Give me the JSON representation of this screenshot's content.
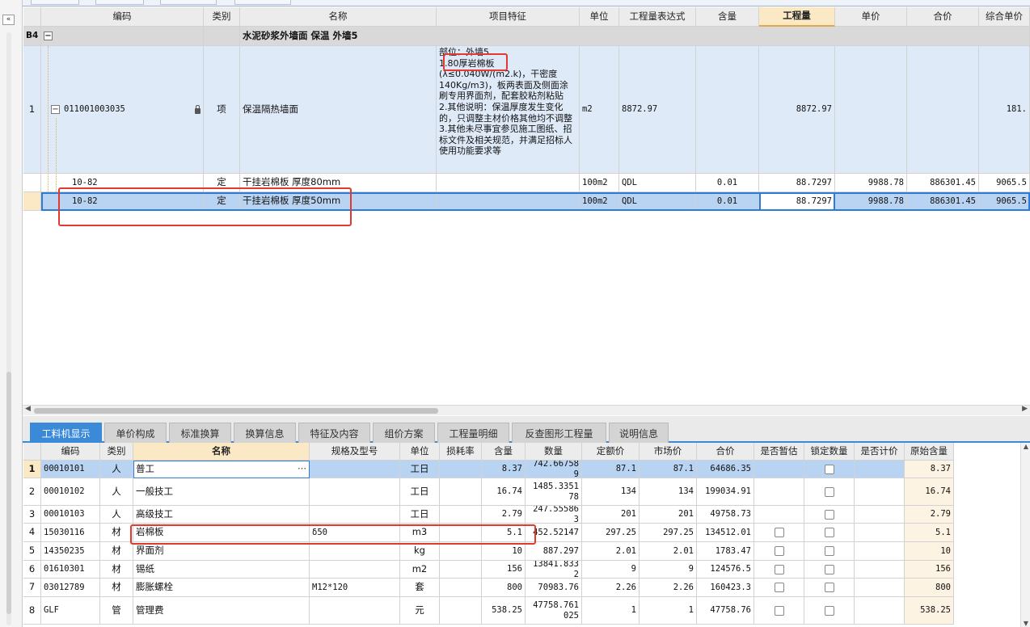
{
  "window": {
    "collapse_label": "«"
  },
  "top_table": {
    "headers": [
      "编码",
      "类别",
      "名称",
      "项目特征",
      "单位",
      "工程量表达式",
      "含量",
      "工程量",
      "单价",
      "合价",
      "综合单价"
    ],
    "section_row": {
      "num": "B4",
      "name": "水泥砂浆外墙面 保温 外墙5"
    },
    "item_row": {
      "num": "1",
      "code": "011001003035",
      "type": "项",
      "name": "保温隔热墙面",
      "features": [
        "部位：外墙5",
        "1.80厚岩棉板(λ≤0.040W/(m2.k)，干密度140Kg/m3)，板两表面及侧面涂刷专用界面剂，配套胶粘剂粘贴",
        "2.其他说明：保温厚度发生变化的，只调整主材价格其他均不调整",
        "3.其他未尽事宜参见施工图纸、招标文件及相关规范，并满足招标人使用功能要求等"
      ],
      "unit": "m2",
      "expr": "8872.97",
      "qty": "8872.97",
      "unit_price": "",
      "total": "",
      "comp_price": "181."
    },
    "sub_rows": [
      {
        "code": "10-82",
        "type": "定",
        "name": "干挂岩棉板 厚度80mm",
        "unit": "100m2",
        "expr": "QDL",
        "content": "0.01",
        "qty": "88.7297",
        "unit_price": "9988.78",
        "total": "886301.45",
        "comp_price": "9065.5"
      },
      {
        "code": "10-82",
        "type": "定",
        "name": "干挂岩棉板 厚度50mm",
        "unit": "100m2",
        "expr": "QDL",
        "content": "0.01",
        "qty": "88.7297",
        "unit_price": "9988.78",
        "total": "886301.45",
        "comp_price": "9065.5"
      }
    ]
  },
  "bottom_tabs": [
    "工料机显示",
    "单价构成",
    "标准换算",
    "换算信息",
    "特征及内容",
    "组价方案",
    "工程量明细",
    "反查图形工程量",
    "说明信息"
  ],
  "bottom_table": {
    "headers": [
      "编码",
      "类别",
      "名称",
      "规格及型号",
      "单位",
      "损耗率",
      "含量",
      "数量",
      "定额价",
      "市场价",
      "合价",
      "是否暂估",
      "锁定数量",
      "是否计价",
      "原始含量"
    ],
    "rows": [
      {
        "num": "1",
        "code": "00010101",
        "type": "人",
        "name": "普工",
        "spec": "",
        "unit": "工日",
        "loss": "",
        "content": "8.37",
        "qty": "742.667589",
        "base_price": "87.1",
        "market_price": "87.1",
        "total": "64686.35",
        "provisional": false,
        "locked": false,
        "priced": "",
        "orig": "8.37"
      },
      {
        "num": "2",
        "code": "00010102",
        "type": "人",
        "name": "一般技工",
        "spec": "",
        "unit": "工日",
        "loss": "",
        "content": "16.74",
        "qty": "1485.335178",
        "base_price": "134",
        "market_price": "134",
        "total": "199034.91",
        "provisional": false,
        "locked": false,
        "priced": "",
        "orig": "16.74"
      },
      {
        "num": "3",
        "code": "00010103",
        "type": "人",
        "name": "高级技工",
        "spec": "",
        "unit": "工日",
        "loss": "",
        "content": "2.79",
        "qty": "247.555863",
        "base_price": "201",
        "market_price": "201",
        "total": "49758.73",
        "provisional": false,
        "locked": false,
        "priced": "",
        "orig": "2.79"
      },
      {
        "num": "4",
        "code": "15030116",
        "type": "材",
        "name": "岩棉板",
        "spec": "δ50",
        "unit": "m3",
        "loss": "",
        "content": "5.1",
        "qty": "452.52147",
        "base_price": "297.25",
        "market_price": "297.25",
        "total": "134512.01",
        "provisional": true,
        "locked": false,
        "priced": "",
        "orig": "5.1"
      },
      {
        "num": "5",
        "code": "14350235",
        "type": "材",
        "name": "界面剂",
        "spec": "",
        "unit": "kg",
        "loss": "",
        "content": "10",
        "qty": "887.297",
        "base_price": "2.01",
        "market_price": "2.01",
        "total": "1783.47",
        "provisional": true,
        "locked": false,
        "priced": "",
        "orig": "10"
      },
      {
        "num": "6",
        "code": "01610301",
        "type": "材",
        "name": "锡纸",
        "spec": "",
        "unit": "m2",
        "loss": "",
        "content": "156",
        "qty": "13841.8332",
        "base_price": "9",
        "market_price": "9",
        "total": "124576.5",
        "provisional": true,
        "locked": false,
        "priced": "",
        "orig": "156"
      },
      {
        "num": "7",
        "code": "03012789",
        "type": "材",
        "name": "膨胀螺栓",
        "spec": "M12*120",
        "unit": "套",
        "loss": "",
        "content": "800",
        "qty": "70983.76",
        "base_price": "2.26",
        "market_price": "2.26",
        "total": "160423.3",
        "provisional": true,
        "locked": false,
        "priced": "",
        "orig": "800"
      },
      {
        "num": "8",
        "code": "GLF",
        "type": "管",
        "name": "管理费",
        "spec": "",
        "unit": "元",
        "loss": "",
        "content": "538.25",
        "qty": "47758.761025",
        "base_price": "1",
        "market_price": "1",
        "total": "47758.76",
        "provisional": true,
        "locked": false,
        "priced": "",
        "orig": "538.25"
      }
    ],
    "row1_edit_ellipsis": "···"
  },
  "colors": {
    "accent": "#3a8ad8",
    "selected_row": "#b9d4f2",
    "item_row": "#dfeaf9",
    "highlight_header": "#fbe9c5",
    "annotation": "#e23a2f"
  }
}
